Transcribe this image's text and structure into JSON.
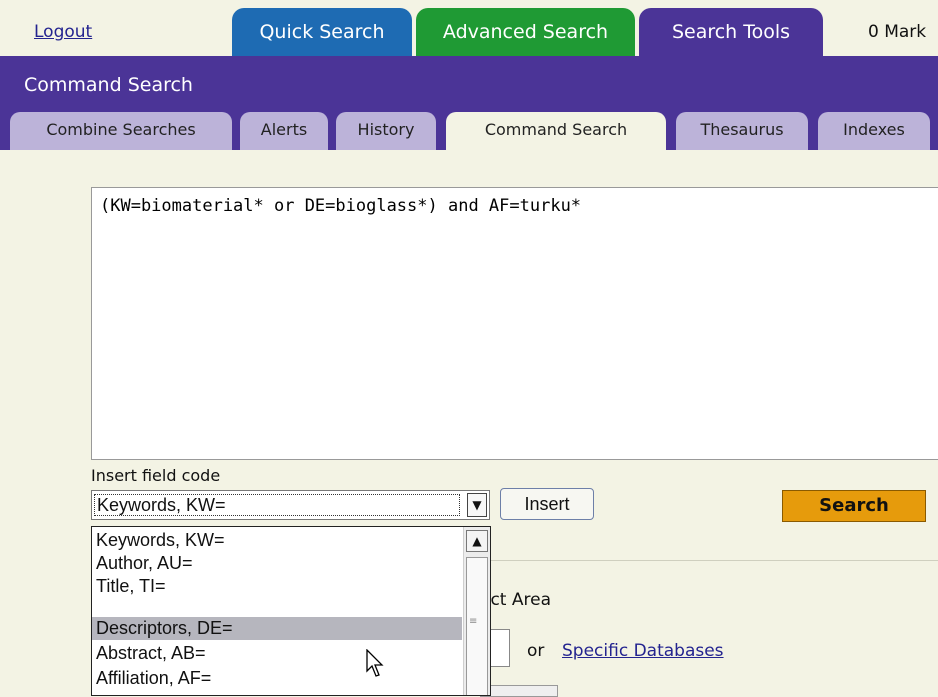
{
  "top_nav": {
    "logout": "Logout",
    "tabs": [
      {
        "label": "Quick Search",
        "color": "#1e6bb3"
      },
      {
        "label": "Advanced Search",
        "color": "#1f9a34"
      },
      {
        "label": "Search Tools",
        "color": "#4b3497",
        "active": true
      }
    ],
    "marked_items": "0 Mark"
  },
  "header": {
    "title": "Command Search"
  },
  "sub_tabs": [
    {
      "label": "Combine Searches"
    },
    {
      "label": "Alerts"
    },
    {
      "label": "History"
    },
    {
      "label": "Command Search",
      "active": true
    },
    {
      "label": "Thesaurus"
    },
    {
      "label": "Indexes"
    }
  ],
  "query": {
    "value": "(KW=biomaterial* or DE=bioglass*) and AF=turku*"
  },
  "field_code": {
    "label": "Insert field code",
    "selected": "Keywords, KW=",
    "options": [
      "Keywords, KW=",
      "Author, AU=",
      "Title, TI=",
      "Descriptors, DE=",
      "Abstract, AB=",
      "Affiliation, AF="
    ],
    "highlighted": "Descriptors, DE="
  },
  "buttons": {
    "insert": "Insert",
    "search": "Search"
  },
  "databases": {
    "subject_area_fragment": "ect Area",
    "or": "or",
    "specific_link": "Specific Databases"
  },
  "colors": {
    "purple": "#4b3497",
    "search_button": "#e69b0c",
    "page_bg": "#f3f3e4"
  }
}
